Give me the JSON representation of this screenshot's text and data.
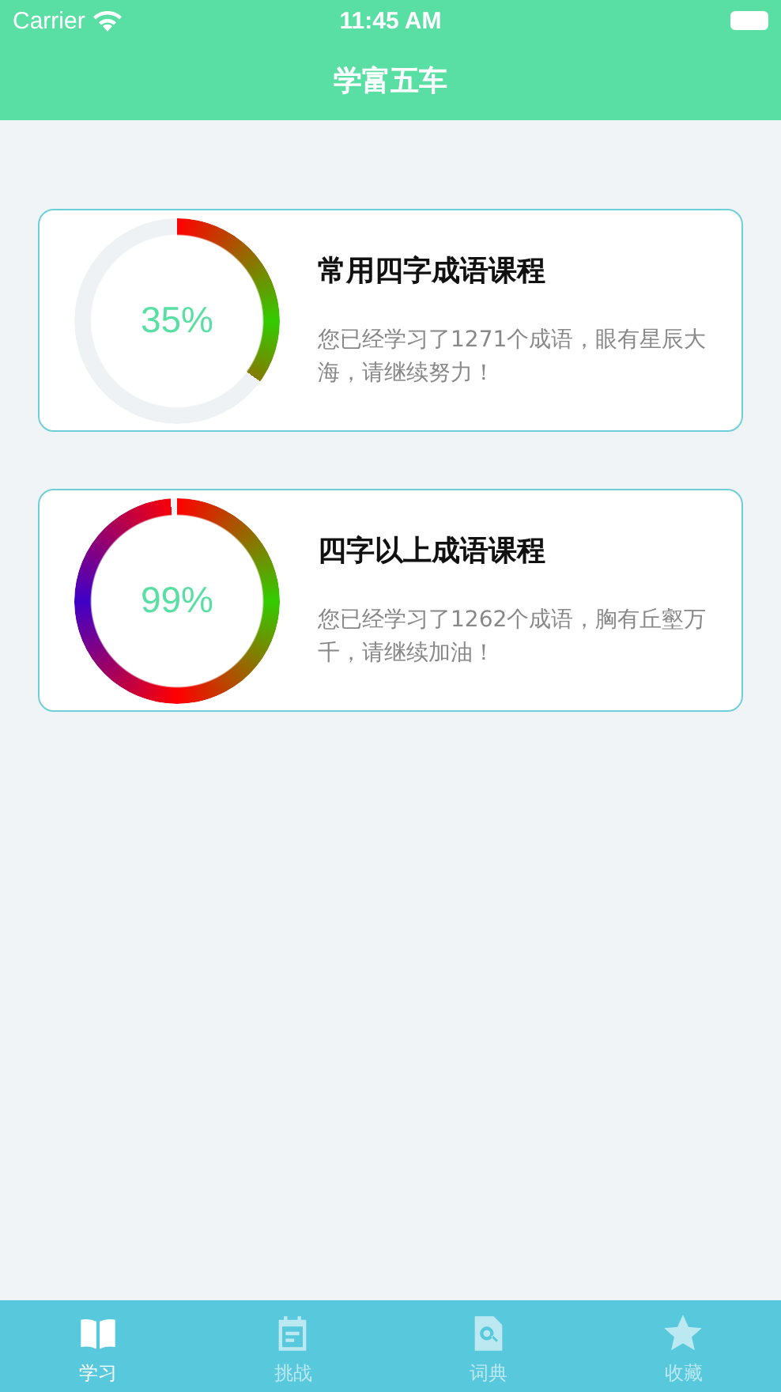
{
  "status_bar": {
    "carrier": "Carrier",
    "time": "11:45 AM"
  },
  "nav_bar": {
    "title": "学富五车"
  },
  "courses": [
    {
      "title": "常用四字成语课程",
      "percent": "35%",
      "description": "您已经学习了1271个成语，眼有星辰大海，请继续努力！"
    },
    {
      "title": "四字以上成语课程",
      "percent": "99%",
      "description": "您已经学习了1262个成语，胸有丘壑万千，请继续加油！"
    }
  ],
  "tab_bar": [
    {
      "label": "学习",
      "kind": "book",
      "selected": true
    },
    {
      "label": "挑战",
      "kind": "calendar",
      "selected": false
    },
    {
      "label": "词典",
      "kind": "search",
      "selected": false
    },
    {
      "label": "收藏",
      "kind": "star",
      "selected": false
    }
  ]
}
